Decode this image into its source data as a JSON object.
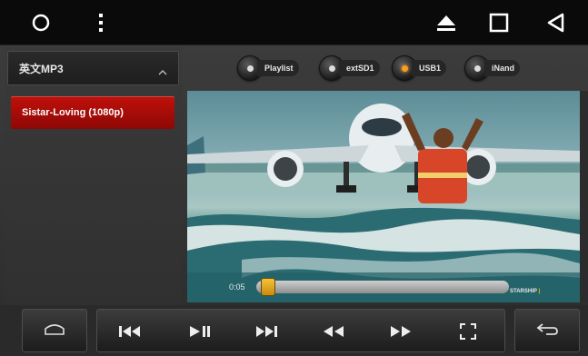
{
  "source": {
    "folder_label": "英文MP3",
    "items": [
      {
        "label": "Playlist",
        "active": false
      },
      {
        "label": "extSD1",
        "active": false
      },
      {
        "label": "USB1",
        "active": true
      },
      {
        "label": "iNand",
        "active": false
      }
    ]
  },
  "playlist": {
    "tracks": [
      {
        "title": "Sistar-Loving (1080p)",
        "selected": true
      }
    ]
  },
  "player": {
    "elapsed": "0:05",
    "progress_fraction": 0.02,
    "watermark_a": "STARSHIP",
    "watermark_b": "ENTERTAINMENT",
    "watermark_sep": "|"
  },
  "icons": {
    "top": [
      "circle-home-icon",
      "menu-dots-icon",
      "eject-icon",
      "square-recents-icon",
      "back-triangle-icon"
    ],
    "bottom": [
      "home-icon",
      "previous-track-icon",
      "play-pause-icon",
      "next-track-icon",
      "rewind-icon",
      "fast-forward-icon",
      "fullscreen-icon",
      "return-icon"
    ]
  },
  "colors": {
    "accent_active": "#ff9a1a",
    "selected_track": "#b30d08",
    "progress_thumb": "#e6a91f"
  }
}
